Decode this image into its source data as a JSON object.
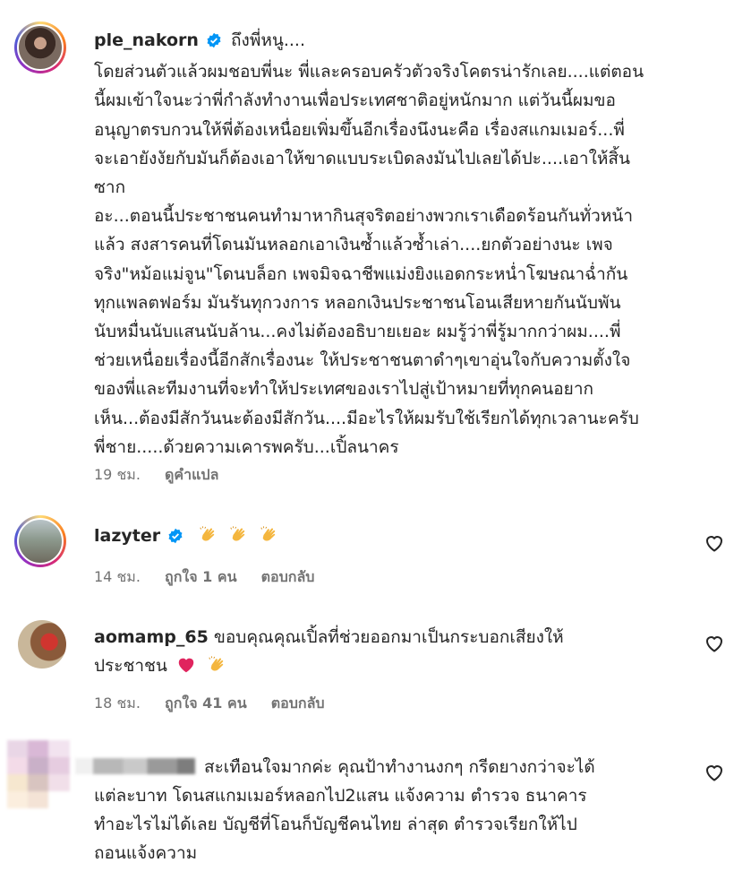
{
  "comments": [
    {
      "username": "ple_nakorn",
      "verified": true,
      "lines": [
        "ถึงพี่หนู....",
        "โดยส่วนตัวแล้วผมชอบพี่นะ พี่และครอบครัวตัวจริงโคตรน่ารักเลย....แต่ตอน",
        "นี้ผมเข้าใจนะว่าพี่กำลังทำงานเพื่อประเทศชาติอยู่หนักมาก แต่วันนี้ผมขอ",
        "อนุญาตรบกวนให้พี่ต้องเหนื่อยเพิ่มขึ้นอีกเรื่องนึงนะคือ เรื่องสแกมเมอร์...พี่",
        "จะเอายังงัยกับมันก็ต้องเอาให้ขาดแบบระเบิดลงมันไปเลยได้ปะ....เอาให้สิ้น",
        "ซาก",
        "อะ...ตอนนี้ประชาชนคนทำมาหากินสุจริตอย่างพวกเราเดือดร้อนกันทั่วหน้า",
        "แล้ว สงสารคนที่โดนมันหลอกเอาเงินซ้ำแล้วซ้ำเล่า....ยกตัวอย่างนะ เพจ",
        "จริง\"หม้อแม่จูน\"โดนบล็อก เพจมิจฉาชีพแม่งยิงแอดกระหน่ำโฆษณาฉ่ำกัน",
        "ทุกแพลตฟอร์ม มันรันทุกวงการ หลอกเงินประชาชนโอนเสียหายกันนับพัน",
        "นับหมื่นนับแสนนับล้าน...คงไม่ต้องอธิบายเยอะ ผมรู้ว่าพี่รู้มากกว่าผม....พี่",
        "ช่วยเหนื่อยเรื่องนี้อีกสักเรื่องนะ ให้ประชาชนตาดำๆเขาอุ่นใจกับความตั้งใจ",
        "ของพี่และทีมงานที่จะทำให้ประเทศของเราไปสู่เป้าหมายที่ทุกคนอยาก",
        "เห็น...ต้องมีสักวันนะต้องมีสักวัน....มีอะไรให้ผมรับใช้เรียกได้ทุกเวลานะครับ",
        "พี่ชาย.....ด้วยความเคารพครับ...เปิ้ลนาคร"
      ],
      "time": "19 ชม.",
      "action": "ดูคำแปล"
    },
    {
      "username": "lazyter",
      "verified": true,
      "emoji": [
        "clapping-hands",
        "clapping-hands",
        "clapping-hands"
      ],
      "time": "14 ชม.",
      "likes": "ถูกใจ 1 คน",
      "reply": "ตอบกลับ"
    },
    {
      "username": "aomamp_65",
      "verified": false,
      "line1": "ขอบคุณคุณเปิ้ลที่ช่วยออกมาเป็นกระบอกเสียงให้",
      "line2": "ประชาชน",
      "emoji": [
        "red-heart",
        "clapping-hands"
      ],
      "time": "18 ชม.",
      "likes": "ถูกใจ 41 คน",
      "reply": "ตอบกลับ"
    },
    {
      "username_hidden": true,
      "lines": [
        "สะเทือนใจมากค่ะ คุณป้าทำงานงกๆ กรีดยางกว่าจะได้",
        "แต่ละบาท โดนสแกมเมอร์หลอกไป2แสน แจ้งความ ตำรวจ ธนาคาร",
        "ทำอะไรไม่ได้เลย บัญชีที่โอนก็บัญชีคนไทย ล่าสุด ตำรวจเรียกให้ไป",
        "ถอนแจ้งความ"
      ]
    }
  ],
  "colors": {
    "verified": "#0095f6",
    "heart": "#ed4956",
    "meta": "#737373",
    "text": "#262626"
  }
}
